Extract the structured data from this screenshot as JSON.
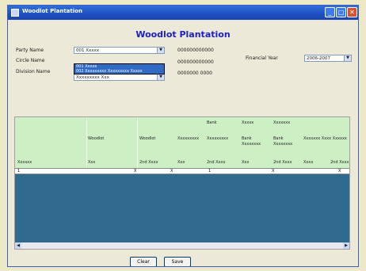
{
  "window": {
    "title": "Woodlot Plantation"
  },
  "form": {
    "title": "Woodlot Plantation"
  },
  "fields": {
    "party_name": {
      "label": "Party Name",
      "value": "001 Xxxxx"
    },
    "circle_name": {
      "label": "Circle Name",
      "value": ""
    },
    "division_name": {
      "label": "Division Name",
      "value": "Xxxxxxxxx Xxx"
    },
    "code1": "000000000000",
    "code2": "000000000000",
    "code3": "0000000 0000",
    "financial_year": {
      "label": "Financial Year",
      "value": "2006-2007"
    }
  },
  "dropdown_items": [
    "001 Xxxxx",
    "002 Xxxxxxxxx Xxxxxxxxx Xxxxx"
  ],
  "grid": {
    "top_headers": [
      "Bank",
      "Xxxxx",
      "Xxxxxxx"
    ],
    "mid_headers": [
      "Woodlot",
      "Woodlot",
      "Xxxxxxxxx",
      "Xxxxxxxxx",
      "Bank",
      "Bank",
      "Xxxxxxx Xxxx Xxxxxx"
    ],
    "mid_headers2": [
      "Xxxxxxxx",
      "Xxxxxxxx"
    ],
    "bottom_headers": [
      "Xxxxxx",
      "Xxx",
      "2nd Xxxx",
      "Xxx",
      "2nd Xxxx",
      "Xxx",
      "2nd Xxxx",
      "Xxxx",
      "2nd Xxxx"
    ],
    "row": {
      "c1": "1",
      "v1": "X",
      "v2": "X",
      "v3": "1",
      "v4": "X",
      "v5": "X"
    }
  },
  "buttons": {
    "clear": "Clear",
    "save": "Save"
  }
}
